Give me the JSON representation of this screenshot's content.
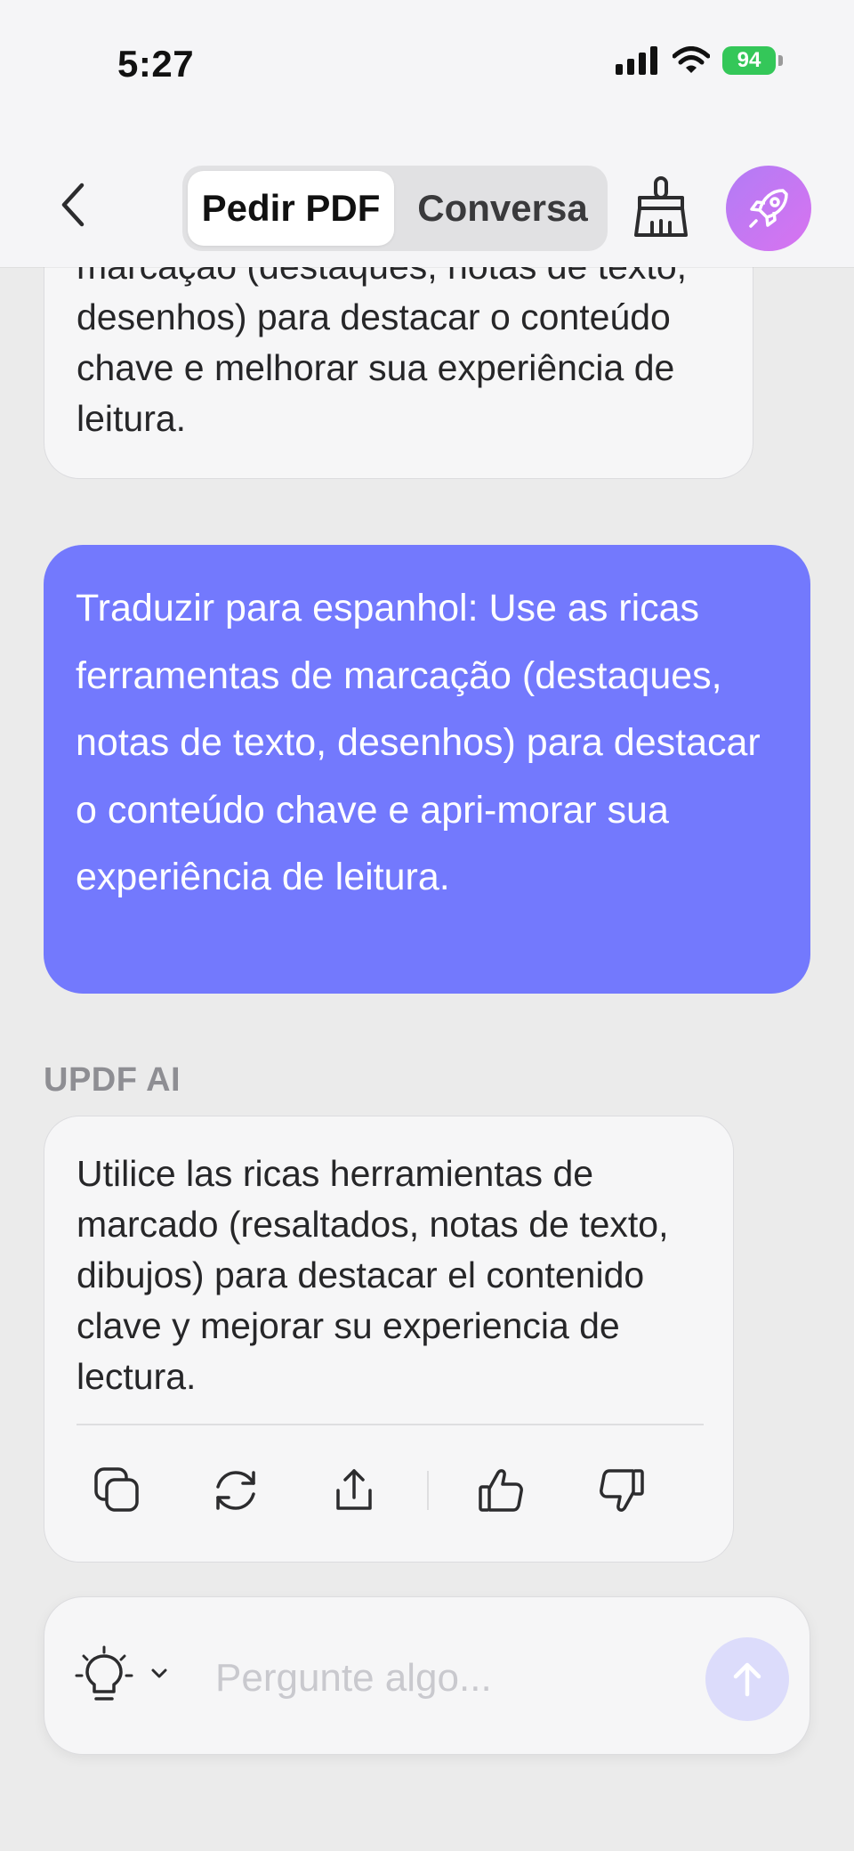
{
  "status_bar": {
    "time": "5:27",
    "battery": "94",
    "icons": [
      "cellular-signal-icon",
      "wifi-icon",
      "battery-charging-icon"
    ]
  },
  "nav": {
    "back_icon": "chevron-left-icon",
    "tabs": [
      {
        "label": "Pedir PDF",
        "active": true
      },
      {
        "label": "Conversa",
        "active": false
      }
    ],
    "clear_icon": "broom-icon",
    "upgrade_icon": "rocket-icon"
  },
  "messages": {
    "previous_ai_text": "marcação (destaques, notas de texto, desenhos) para destacar o conteúdo chave e melhorar sua experiência de leitura.",
    "user_text": "Traduzir para espanhol: Use as ricas ferramentas de marcação (destaques, notas de texto, desenhos) para destacar o conteúdo chave e apri-morar sua experiência de leitura.",
    "ai_label": "UPDF AI",
    "ai_text": "Utilice las ricas herramientas de marcado (resaltados, notas de texto, dibujos) para destacar el contenido clave y mejorar su experiencia de lectura.",
    "actions": [
      "copy-icon",
      "regenerate-icon",
      "share-icon",
      "thumbs-up-icon",
      "thumbs-down-icon"
    ]
  },
  "composer": {
    "prompt_icon": "lightbulb-icon",
    "placeholder": "Pergunte algo...",
    "value": "",
    "send_icon": "arrow-up-icon"
  },
  "colors": {
    "user_bubble": "#7379fd",
    "accent_gradient_start": "#b27cf5",
    "accent_gradient_end": "#d873f0",
    "battery": "#34c759",
    "send_disabled": "#dcdcfb"
  }
}
